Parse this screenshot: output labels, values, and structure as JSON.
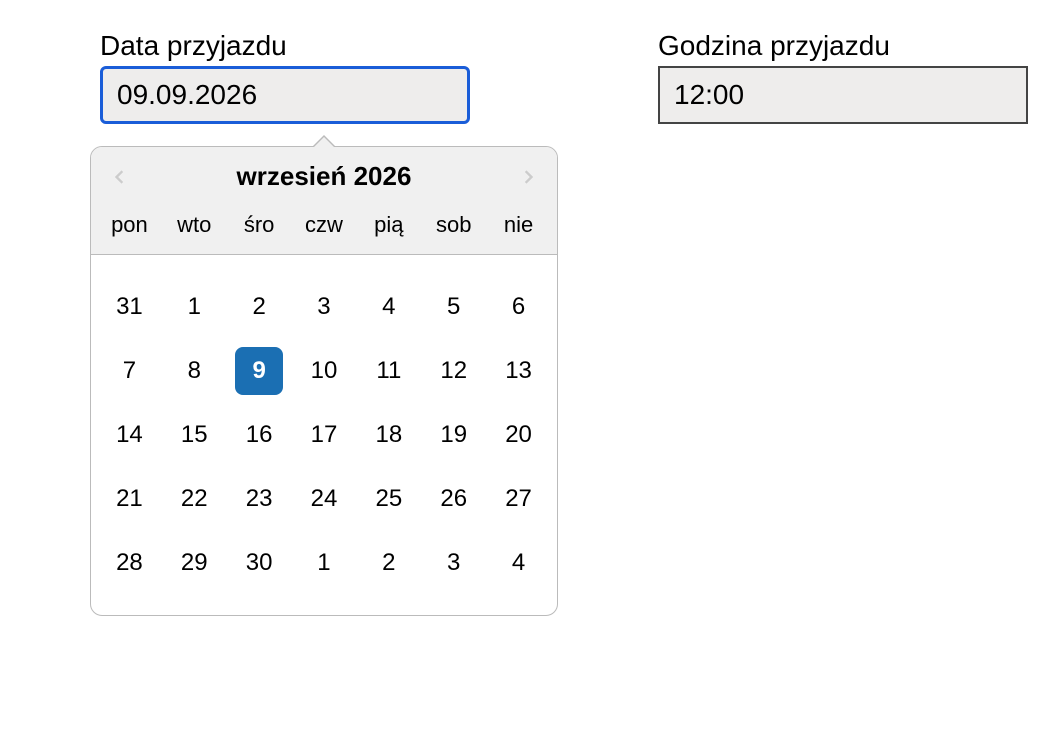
{
  "fields": {
    "arrival_date": {
      "label": "Data przyjazdu",
      "value": "09.09.2026"
    },
    "arrival_time": {
      "label": "Godzina przyjazdu",
      "value": "12:00"
    }
  },
  "datepicker": {
    "title": "wrzesień 2026",
    "weekdays": [
      "pon",
      "wto",
      "śro",
      "czw",
      "pią",
      "sob",
      "nie"
    ],
    "selected_day": 9,
    "weeks": [
      [
        {
          "d": 31,
          "other": true
        },
        {
          "d": 1
        },
        {
          "d": 2
        },
        {
          "d": 3
        },
        {
          "d": 4
        },
        {
          "d": 5
        },
        {
          "d": 6
        }
      ],
      [
        {
          "d": 7
        },
        {
          "d": 8
        },
        {
          "d": 9,
          "selected": true
        },
        {
          "d": 10
        },
        {
          "d": 11
        },
        {
          "d": 12
        },
        {
          "d": 13
        }
      ],
      [
        {
          "d": 14
        },
        {
          "d": 15
        },
        {
          "d": 16
        },
        {
          "d": 17
        },
        {
          "d": 18
        },
        {
          "d": 19
        },
        {
          "d": 20
        }
      ],
      [
        {
          "d": 21
        },
        {
          "d": 22
        },
        {
          "d": 23
        },
        {
          "d": 24
        },
        {
          "d": 25
        },
        {
          "d": 26
        },
        {
          "d": 27
        }
      ],
      [
        {
          "d": 28
        },
        {
          "d": 29
        },
        {
          "d": 30
        },
        {
          "d": 1,
          "other": true
        },
        {
          "d": 2,
          "other": true
        },
        {
          "d": 3,
          "other": true
        },
        {
          "d": 4,
          "other": true
        }
      ]
    ]
  }
}
